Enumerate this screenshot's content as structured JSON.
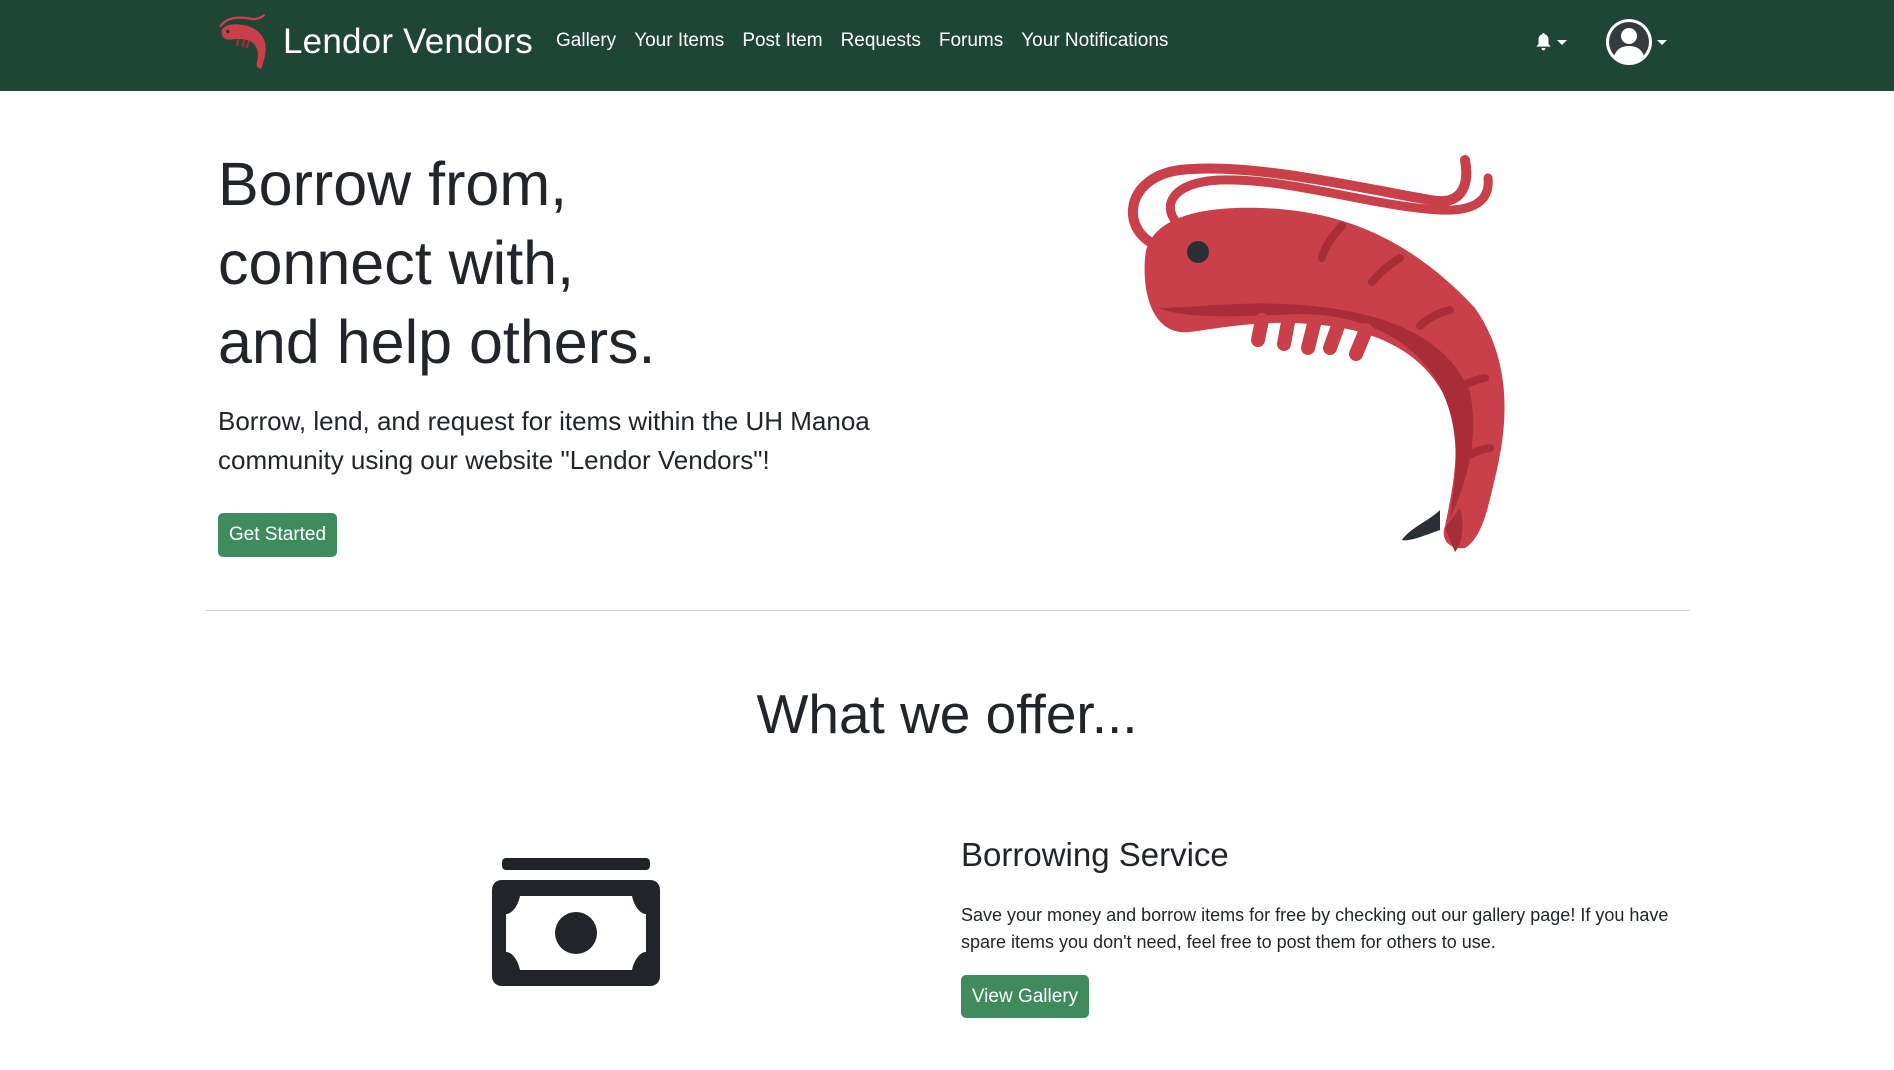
{
  "navbar": {
    "brand": "Lendor Vendors",
    "logo_icon": "shrimp-icon",
    "links": [
      "Gallery",
      "Your Items",
      "Post Item",
      "Requests",
      "Forums",
      "Your Notifications"
    ],
    "notification_icon": "bell-icon",
    "account_icon": "user-circle-icon",
    "background_color": "#1e4535"
  },
  "hero": {
    "title_lines": [
      "Borrow from,",
      "connect with,",
      "and help others."
    ],
    "lead": "Borrow, lend, and request for items within the UH Manoa community using our website \"Lendor Vendors\"!",
    "cta_label": "Get Started",
    "image_icon": "shrimp-icon"
  },
  "offer": {
    "heading": "What we offer...",
    "service": {
      "icon": "money-bill-icon",
      "title": "Borrowing Service",
      "description": "Save your money and borrow items for free by checking out our gallery page! If you have spare items you don't need, feel free to post them for others to use.",
      "button_label": "View Gallery"
    }
  },
  "colors": {
    "accent_green": "#3f8b5e",
    "shrimp_red": "#c9404b"
  }
}
